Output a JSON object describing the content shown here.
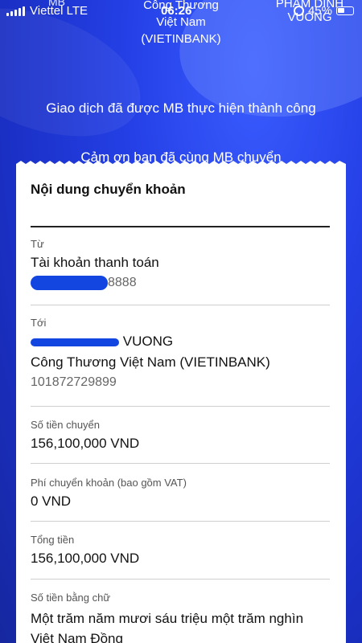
{
  "status_bar": {
    "carrier": "Viettel LTE",
    "time": "06:26",
    "battery": "45%"
  },
  "header": {
    "source_bank": "MB",
    "bank_name": "Công Thương Việt Nam (VIETINBANK)",
    "recipient_name": "PHAM DINH VUONG",
    "success_message": "Giao dịch đã được MB thực hiện thành công",
    "thanks_message": "Cảm ơn bạn đã cùng MB chuyển"
  },
  "card": {
    "title": "Nội dung chuyển khoản",
    "from": {
      "label": "Từ",
      "account_type": "Tài khoản thanh toán",
      "account_suffix": "8888"
    },
    "to": {
      "label": "Tới",
      "name_suffix": "VUONG",
      "bank": "Công Thương Việt Nam (VIETINBANK)",
      "account_number": "101872729899"
    },
    "amount": {
      "label": "Số tiền chuyển",
      "value": "156,100,000 VND"
    },
    "fee": {
      "label": "Phí chuyển khoản (bao gồm VAT)",
      "value": "0 VND"
    },
    "total": {
      "label": "Tổng tiền",
      "value": "156,100,000 VND"
    },
    "words": {
      "label": "Số tiền bằng chữ",
      "value": "Một trăm năm mươi sáu triệu một trăm nghìn Việt Nam Đồng"
    }
  },
  "colors": {
    "background": "#1f3ad8",
    "redaction": "#1345e0"
  }
}
